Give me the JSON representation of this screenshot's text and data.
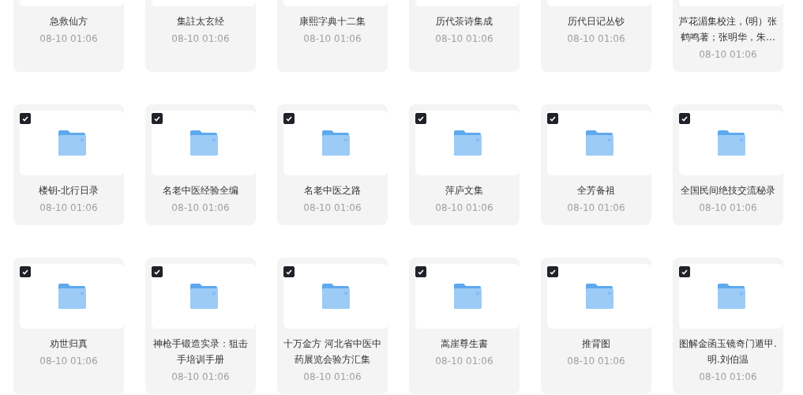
{
  "folders": [
    {
      "title": "急救仙方",
      "date": "08-10 01:06"
    },
    {
      "title": "集註太玄经",
      "date": "08-10 01:06"
    },
    {
      "title": "康熙字典十二集",
      "date": "08-10 01:06"
    },
    {
      "title": "历代茶诗集成",
      "date": "08-10 01:06"
    },
    {
      "title": "历代日记丛钞",
      "date": "08-10 01:06"
    },
    {
      "title": "芦花湄集校注，(明）张鹤鸣著；张明华，朱...",
      "date": "08-10 01:06"
    },
    {
      "title": "楼钥-北行日录",
      "date": "08-10 01:06",
      "checked": true
    },
    {
      "title": "名老中医经验全编",
      "date": "08-10 01:06",
      "checked": true
    },
    {
      "title": "名老中医之路",
      "date": "08-10 01:06",
      "checked": true
    },
    {
      "title": "萍庐文集",
      "date": "08-10 01:06",
      "checked": true
    },
    {
      "title": "全芳备祖",
      "date": "08-10 01:06",
      "checked": true
    },
    {
      "title": "全国民间绝技交流秘录",
      "date": "08-10 01:06",
      "checked": true
    },
    {
      "title": "劝世归真",
      "date": "08-10 01:06",
      "checked": true
    },
    {
      "title": "神枪手锻造实录：狙击手培训手册",
      "date": "08-10 01:06",
      "checked": true
    },
    {
      "title": "十万金方 河北省中医中药展览会验方汇集",
      "date": "08-10 01:06",
      "checked": true
    },
    {
      "title": "嵩崖尊生書",
      "date": "08-10 01:06",
      "checked": true
    },
    {
      "title": "推背图",
      "date": "08-10 01:06",
      "checked": true
    },
    {
      "title": "图解金函玉镜奇门遁甲.明.刘伯温",
      "date": "08-10 01:06",
      "checked": true
    }
  ]
}
